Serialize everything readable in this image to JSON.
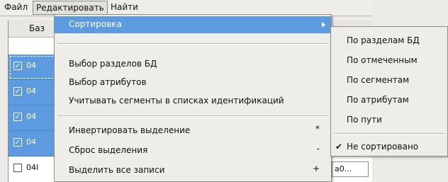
{
  "menubar": {
    "file": "Файл",
    "edit": "Редактировать",
    "find": "Найти"
  },
  "table": {
    "header": "Баз",
    "rows": [
      {
        "text": "04",
        "checked": true,
        "selected": true
      },
      {
        "text": "04",
        "checked": true,
        "selected": true
      },
      {
        "text": "04",
        "checked": true,
        "selected": true
      },
      {
        "text": "04",
        "checked": true,
        "selected": true
      },
      {
        "text": "04l",
        "checked": false,
        "selected": false
      }
    ],
    "right_cell": "a0..."
  },
  "edit_menu": {
    "sort": "Сортировка",
    "select_db_sections": "Выбор разделов БД",
    "select_attributes": "Выбор атрибутов",
    "consider_segments": "Учитывать сегменты в списках идентификаций",
    "invert_selection": "Инвертировать выделение",
    "invert_shortcut": "*",
    "reset_selection": "Сброс выделения",
    "reset_shortcut": "-",
    "select_all": "Выделить все записи",
    "select_all_shortcut": "+"
  },
  "sort_submenu": {
    "by_db_sections": "По разделам БД",
    "by_marked": "По отмеченным",
    "by_segments": "По сегментам",
    "by_attributes": "По атрибутам",
    "by_path": "По пути",
    "not_sorted": "Не сортировано",
    "checked_item": "not_sorted"
  },
  "colors": {
    "highlight": "#5c9be0",
    "menu_bg": "#eeede9"
  }
}
